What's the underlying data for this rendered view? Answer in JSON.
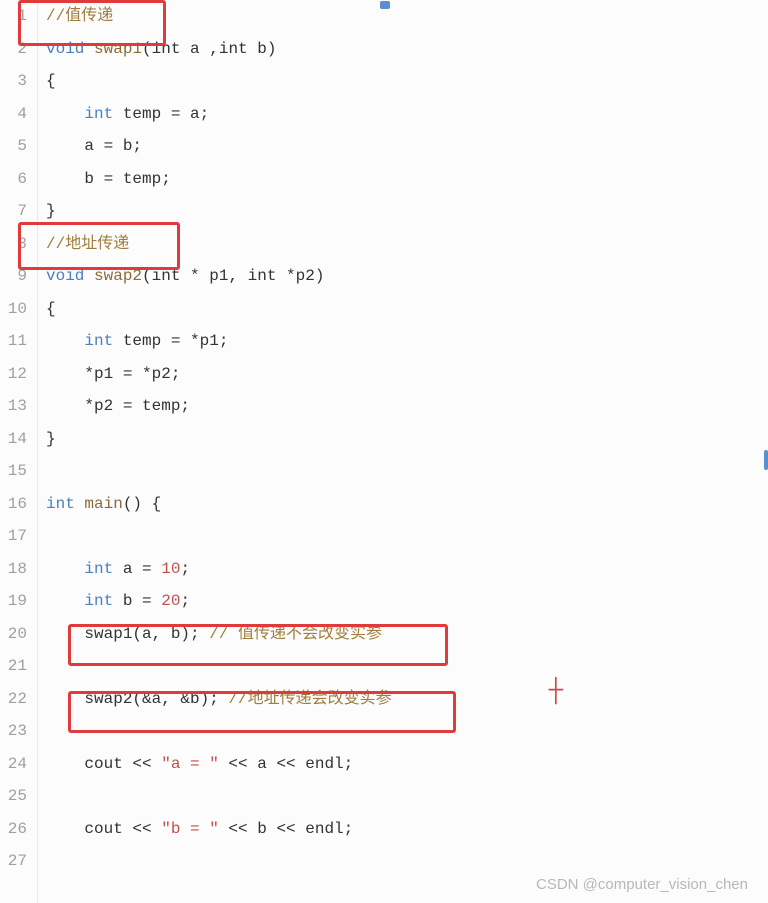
{
  "gutter": [
    "1",
    "2",
    "3",
    "4",
    "5",
    "6",
    "7",
    "8",
    "9",
    "10",
    "11",
    "12",
    "13",
    "14",
    "15",
    "16",
    "17",
    "18",
    "19",
    "20",
    "21",
    "22",
    "23",
    "24",
    "25",
    "26",
    "27"
  ],
  "code": {
    "l1_cm": "//值传递",
    "l2_kw": "void",
    "l2_fn": "swap1",
    "l2_rest": "(int a ,int b)",
    "l3": "{",
    "l4_kw": "int",
    "l4_rest": " temp = a;",
    "l5": "a = b;",
    "l6": "b = temp;",
    "l7": "}",
    "l8_cm": "//地址传递",
    "l9_kw": "void",
    "l9_fn": "swap2",
    "l9_rest": "(int * p1, int *p2)",
    "l10": "{",
    "l11_kw": "int",
    "l11_rest": " temp = *p1;",
    "l12": "*p1 = *p2;",
    "l13": "*p2 = temp;",
    "l14": "}",
    "l15": "",
    "l16_kw": "int",
    "l16_fn": "main",
    "l16_rest": "() {",
    "l17": "",
    "l18_kw": "int",
    "l18_a": " a = ",
    "l18_num": "10",
    "l18_end": ";",
    "l19_kw": "int",
    "l19_a": " b = ",
    "l19_num": "20",
    "l19_end": ";",
    "l20_call": "swap1(a, b); ",
    "l20_cm": "// 值传递不会改变实参",
    "l21": "",
    "l22_call": "swap2(&a, &b); ",
    "l22_cm": "//地址传递会改变实参",
    "l23": "",
    "l24_a": "cout << ",
    "l24_str": "\"a = \"",
    "l24_b": " << a << endl;",
    "l25": "",
    "l26_a": "cout << ",
    "l26_str": "\"b = \"",
    "l26_b": " << b << endl;",
    "l27": ""
  },
  "watermark": "CSDN @computer_vision_chen"
}
